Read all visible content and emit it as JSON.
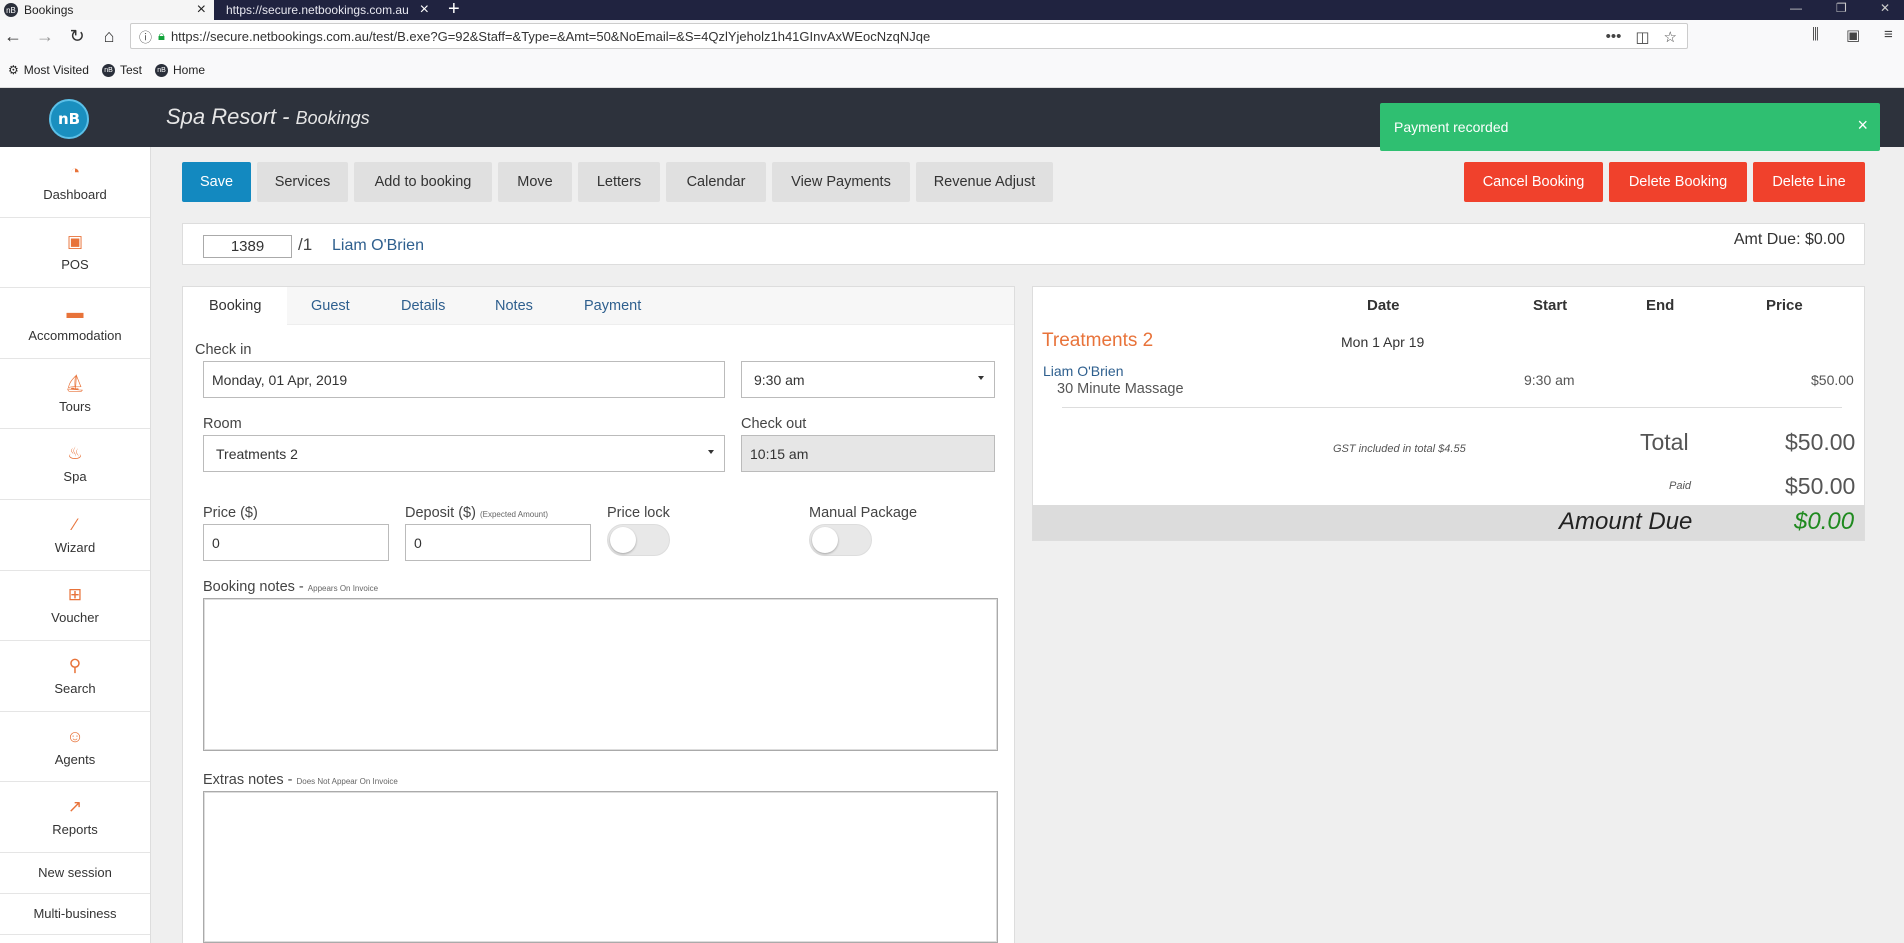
{
  "browser": {
    "tab_active": "Bookings",
    "tab_inactive": "https://secure.netbookings.com.au",
    "url": "https://secure.netbookings.com.au/test/B.exe?G=92&Staff=&Type=&Amt=50&NoEmail=&S=4QzlYjeholz1h41GInvAxWEocNzqNJqe",
    "bookmarks": [
      "Most Visited",
      "Test",
      "Home"
    ]
  },
  "app": {
    "logo_text": "nB",
    "title": "Spa Resort - ",
    "subtitle": "Bookings"
  },
  "toast": {
    "message": "Payment recorded"
  },
  "sidebar": {
    "items": [
      {
        "label": "Dashboard",
        "icon": "speedometer-icon"
      },
      {
        "label": "POS",
        "icon": "pos-icon"
      },
      {
        "label": "Accommodation",
        "icon": "bed-icon"
      },
      {
        "label": "Tours",
        "icon": "tours-icon"
      },
      {
        "label": "Spa",
        "icon": "spa-icon"
      },
      {
        "label": "Wizard",
        "icon": "wand-icon"
      },
      {
        "label": "Voucher",
        "icon": "gift-icon"
      },
      {
        "label": "Search",
        "icon": "search-icon"
      },
      {
        "label": "Agents",
        "icon": "agent-icon"
      },
      {
        "label": "Reports",
        "icon": "chart-icon"
      }
    ],
    "new_session": "New session",
    "multi_business": "Multi-business"
  },
  "toolbar": {
    "save": "Save",
    "services": "Services",
    "add_to_booking": "Add to booking",
    "move": "Move",
    "letters": "Letters",
    "calendar": "Calendar",
    "view_payments": "View Payments",
    "revenue_adjust": "Revenue Adjust",
    "cancel_booking": "Cancel Booking",
    "delete_booking": "Delete Booking",
    "delete_line": "Delete Line"
  },
  "booking_header": {
    "number": "1389",
    "suffix": "/1",
    "guest": "Liam O'Brien",
    "amt_due": "Amt Due: $0.00"
  },
  "form_tabs": [
    "Booking",
    "Guest",
    "Details",
    "Notes",
    "Payment"
  ],
  "form": {
    "check_in_label": "Check in",
    "check_in_date": "Monday, 01 Apr, 2019",
    "check_in_time": "9:30 am",
    "room_label": "Room",
    "room_value": "Treatments 2",
    "check_out_label": "Check out",
    "check_out_value": "10:15 am",
    "price_label": "Price ($)",
    "price_value": "0",
    "deposit_label": "Deposit ($)",
    "deposit_note": "(Expected Amount)",
    "deposit_value": "0",
    "price_lock_label": "Price lock",
    "manual_package_label": "Manual Package",
    "booking_notes_label": "Booking notes - ",
    "booking_notes_note": "Appears On Invoice",
    "extras_notes_label": "Extras notes - ",
    "extras_notes_note": "Does Not Appear On Invoice"
  },
  "summary": {
    "headers": {
      "date": "Date",
      "start": "Start",
      "end": "End",
      "price": "Price"
    },
    "room": "Treatments 2",
    "room_date": "Mon 1 Apr 19",
    "guest": "Liam O'Brien",
    "service": "30 Minute Massage",
    "start": "9:30 am",
    "price": "$50.00",
    "gst_note": "GST included in total $4.55",
    "total_label": "Total",
    "total_value": "$50.00",
    "paid_label": "Paid",
    "paid_value": "$50.00",
    "amount_due_label": "Amount Due",
    "amount_due_value": "$0.00"
  },
  "colors": {
    "save": "#1389c0",
    "danger": "#f0412c",
    "toast": "#2fbf71",
    "accent_orange": "#e8733a",
    "amount_due_green": "#1f8a1f"
  }
}
